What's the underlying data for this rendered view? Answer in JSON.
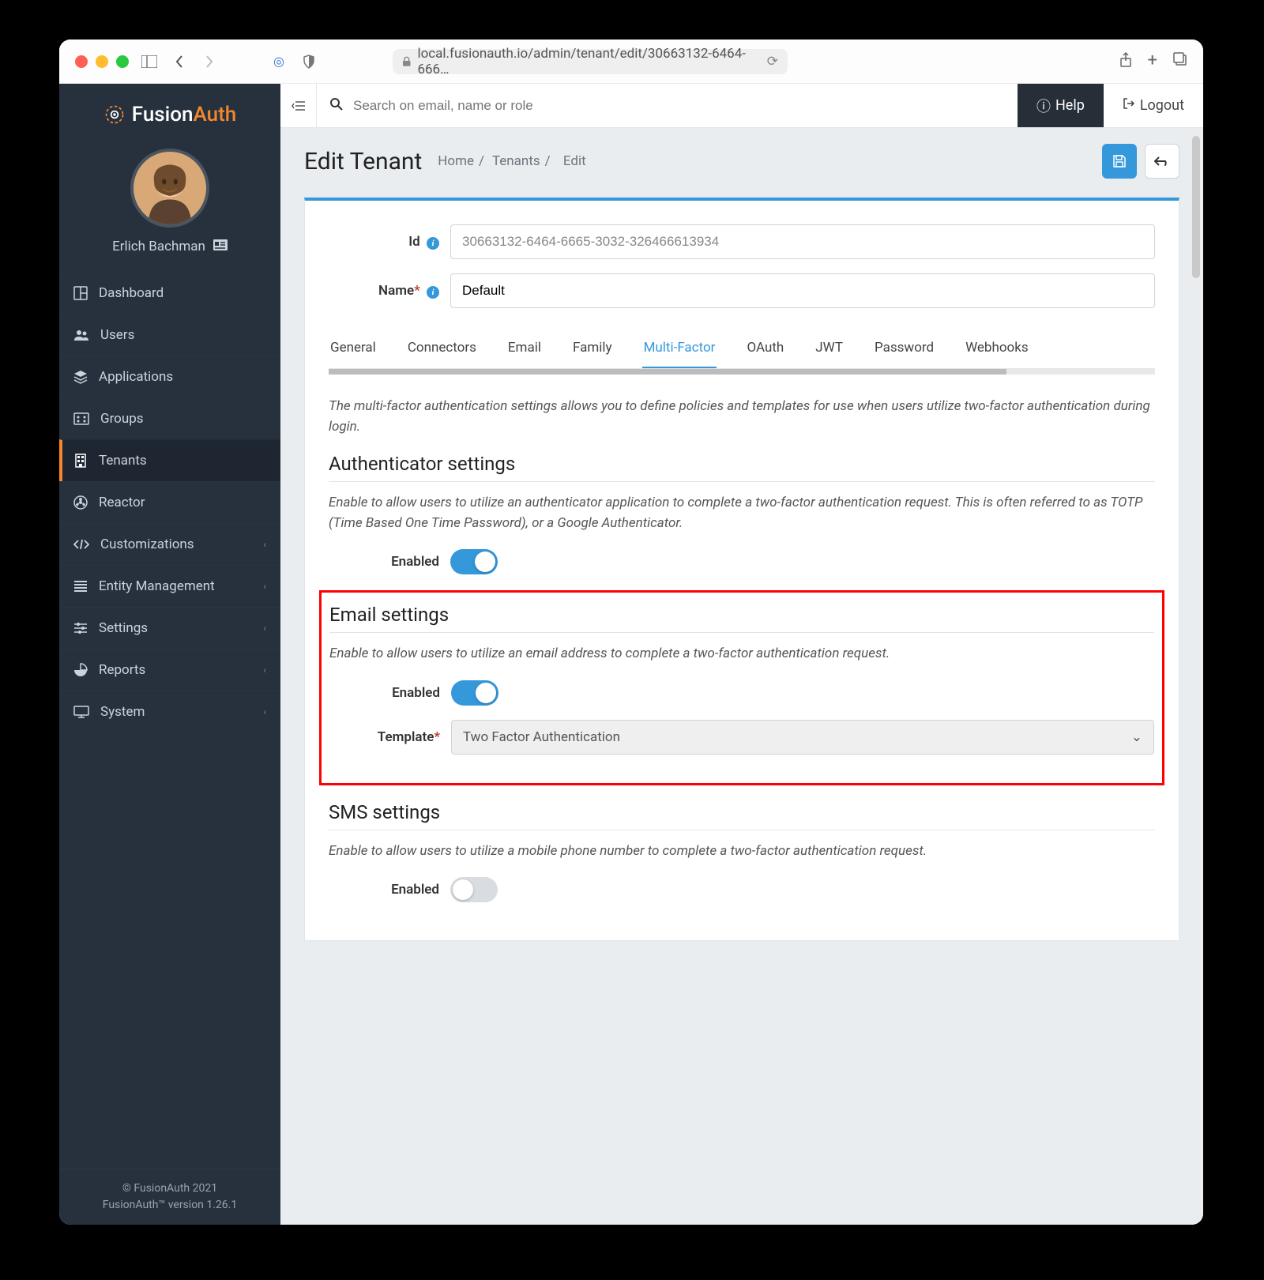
{
  "browser": {
    "url": "local.fusionauth.io/admin/tenant/edit/30663132-6464-666…"
  },
  "brand": {
    "name_part1": "Fusion",
    "name_part2": "Auth"
  },
  "user": {
    "name": "Erlich Bachman"
  },
  "sidebar": {
    "items": [
      {
        "label": "Dashboard",
        "icon": "dashboard"
      },
      {
        "label": "Users",
        "icon": "users"
      },
      {
        "label": "Applications",
        "icon": "applications"
      },
      {
        "label": "Groups",
        "icon": "groups"
      },
      {
        "label": "Tenants",
        "icon": "tenants",
        "active": true
      },
      {
        "label": "Reactor",
        "icon": "reactor"
      },
      {
        "label": "Customizations",
        "icon": "code",
        "expandable": true
      },
      {
        "label": "Entity Management",
        "icon": "entity",
        "expandable": true
      },
      {
        "label": "Settings",
        "icon": "settings",
        "expandable": true
      },
      {
        "label": "Reports",
        "icon": "reports",
        "expandable": true
      },
      {
        "label": "System",
        "icon": "system",
        "expandable": true
      }
    ]
  },
  "footer": {
    "copyright": "© FusionAuth 2021",
    "version": "FusionAuth™ version 1.26.1"
  },
  "topbar": {
    "search_placeholder": "Search on email, name or role",
    "help": "Help",
    "logout": "Logout"
  },
  "page": {
    "title": "Edit Tenant",
    "crumb_home": "Home",
    "crumb_tenants": "Tenants",
    "crumb_edit": "Edit"
  },
  "form": {
    "id_label": "Id",
    "id_value": "30663132-6464-6665-3032-326466613934",
    "name_label": "Name",
    "name_value": "Default"
  },
  "tabs": [
    {
      "label": "General"
    },
    {
      "label": "Connectors"
    },
    {
      "label": "Email"
    },
    {
      "label": "Family"
    },
    {
      "label": "Multi-Factor",
      "active": true
    },
    {
      "label": "OAuth"
    },
    {
      "label": "JWT"
    },
    {
      "label": "Password"
    },
    {
      "label": "Webhooks"
    }
  ],
  "content": {
    "intro": "The multi-factor authentication settings allows you to define policies and templates for use when users utilize two-factor authentication during login.",
    "auth_title": "Authenticator settings",
    "auth_desc": "Enable to allow users to utilize an authenticator application to complete a two-factor authentication request. This is often referred to as TOTP (Time Based One Time Password), or a Google Authenticator.",
    "enabled_label": "Enabled",
    "email_title": "Email settings",
    "email_desc": "Enable to allow users to utilize an email address to complete a two-factor authentication request.",
    "template_label": "Template",
    "template_value": "Two Factor Authentication",
    "sms_title": "SMS settings",
    "sms_desc": "Enable to allow users to utilize a mobile phone number to complete a two-factor authentication request."
  }
}
